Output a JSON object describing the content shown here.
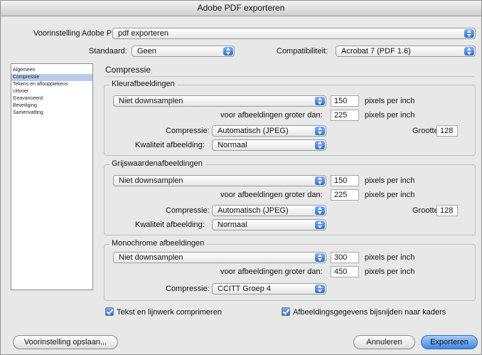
{
  "window": {
    "title": "Adobe PDF exporteren"
  },
  "preset": {
    "label": "Voorinstelling Adobe PDF:",
    "value": "pdf exporteren"
  },
  "standard": {
    "label": "Standaard:",
    "value": "Geen"
  },
  "compat": {
    "label": "Compatibiliteit:",
    "value": "Acrobat 7 (PDF 1.6)"
  },
  "sidebar": {
    "items": [
      {
        "label": "Algemeen"
      },
      {
        "label": "Compressie"
      },
      {
        "label": "Tekens en afloopptekens"
      },
      {
        "label": "Uitvoer"
      },
      {
        "label": "Geavanceerd"
      },
      {
        "label": "Beveiliging"
      },
      {
        "label": "Samenvatting"
      }
    ],
    "selected_index": 1
  },
  "panel": {
    "title": "Compressie"
  },
  "common": {
    "ppi": "pixels per inch",
    "above": "voor afbeeldingen groter dan:",
    "compression_label": "Compressie:",
    "quality_label": "Kwaliteit afbeelding:",
    "size_label": "Grootte:"
  },
  "color": {
    "title": "Kleurafbeeldingen",
    "downsample": "Niet downsamplen",
    "ppi_value": "150",
    "above_value": "225",
    "compression": "Automatisch (JPEG)",
    "size": "128",
    "quality": "Normaal"
  },
  "gray": {
    "title": "Grijswaardenafbeeldingen",
    "downsample": "Niet downsamplen",
    "ppi_value": "150",
    "above_value": "225",
    "compression": "Automatisch (JPEG)",
    "size": "128",
    "quality": "Normaal"
  },
  "mono": {
    "title": "Monochrome afbeeldingen",
    "downsample": "Niet downsamplen",
    "ppi_value": "300",
    "above_value": "450",
    "compression": "CCITT Groep 4"
  },
  "checks": {
    "text": "Tekst en lijnwerk comprimeren",
    "crop": "Afbeeldingsgegevens bijsnijden naar kaders"
  },
  "buttons": {
    "save_preset": "Voorinstelling opslaan...",
    "cancel": "Annuleren",
    "export": "Exporteren"
  },
  "colors": {
    "accent": "#3f86e3",
    "selection": "#b9cde8"
  }
}
